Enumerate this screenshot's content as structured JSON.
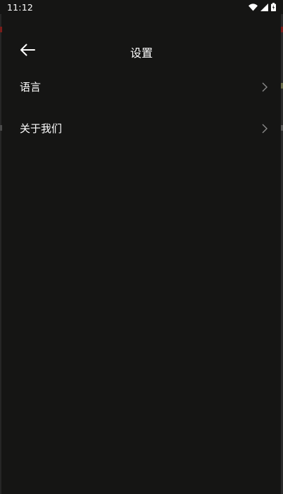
{
  "status_bar": {
    "time": "11:12",
    "icons": [
      "wifi-icon",
      "cellular-signal-icon",
      "battery-icon"
    ]
  },
  "app_bar": {
    "title": "设置",
    "back_icon": "arrow-left-icon"
  },
  "menu": {
    "items": [
      {
        "label": "语言",
        "icon": "chevron-right-icon"
      },
      {
        "label": "关于我们",
        "icon": "chevron-right-icon"
      }
    ]
  },
  "colors": {
    "background": "#151514",
    "text": "#ffffff",
    "chevron": "#8a8a8a"
  }
}
